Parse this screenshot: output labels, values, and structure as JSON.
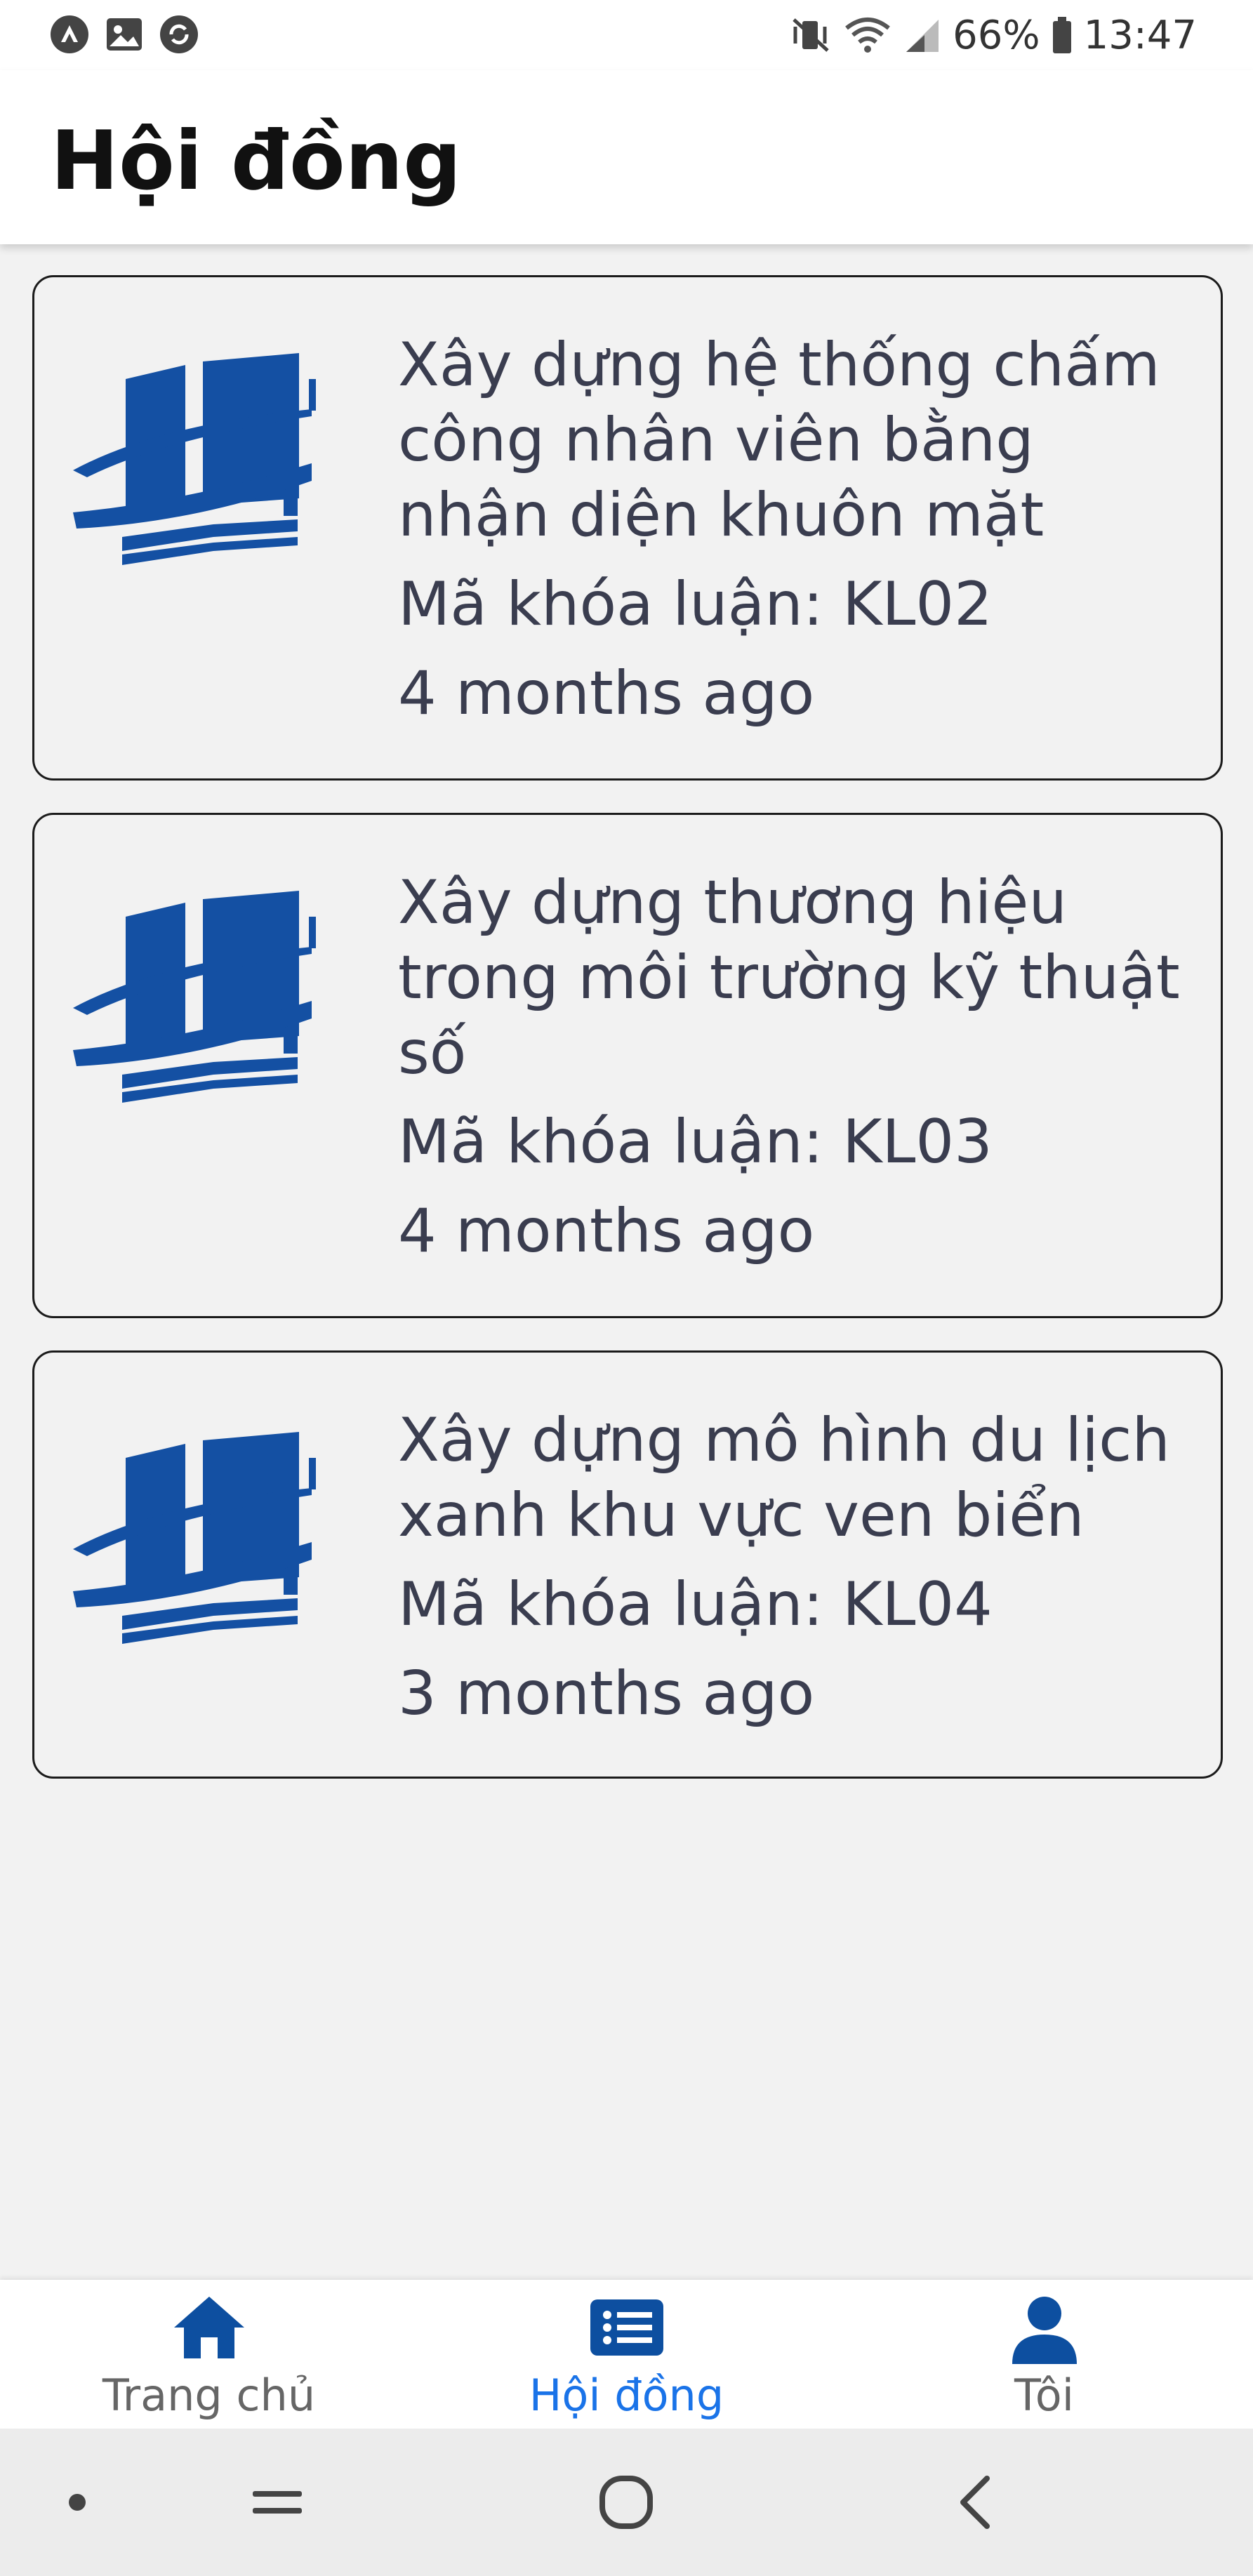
{
  "status_bar": {
    "battery_percent": "66%",
    "time": "13:47",
    "left_icons": [
      "messenger-icon",
      "gallery-icon",
      "sync-icon"
    ],
    "right_icons": [
      "mute-vibrate-icon",
      "wifi-icon",
      "signal-icon",
      "battery-icon"
    ]
  },
  "header": {
    "title": "Hội đồng"
  },
  "theses": [
    {
      "title": "Xây dựng hệ thống chấm công nhân viên bằng nhận diện khuôn mặt",
      "code": "Mã khóa luận: KL02",
      "time": "4 months ago",
      "icon": "book-logo-icon"
    },
    {
      "title": "Xây dựng thương hiệu trong môi trường kỹ thuật số",
      "code": "Mã khóa luận: KL03",
      "time": "4 months ago",
      "icon": "book-logo-icon"
    },
    {
      "title": "Xây dựng mô hình du lịch xanh khu vực ven biển",
      "code": "Mã khóa luận: KL04",
      "time": "3 months ago",
      "icon": "book-logo-icon"
    }
  ],
  "bottom_nav": {
    "items": [
      {
        "label": "Trang chủ",
        "icon": "home-icon",
        "active": false
      },
      {
        "label": "Hội đồng",
        "icon": "list-icon",
        "active": true
      },
      {
        "label": "Tôi",
        "icon": "person-icon",
        "active": false
      }
    ],
    "active_color": "#1a73e8",
    "inactive_label_color": "#666666",
    "icon_color": "#0d4fa0"
  },
  "system_nav": {
    "buttons": [
      "dot-icon",
      "recent-apps-icon",
      "home-circle-icon",
      "back-icon"
    ]
  },
  "colors": {
    "brand_blue": "#1450a3",
    "card_text": "#3a3d4f",
    "background": "#f2f2f2"
  }
}
